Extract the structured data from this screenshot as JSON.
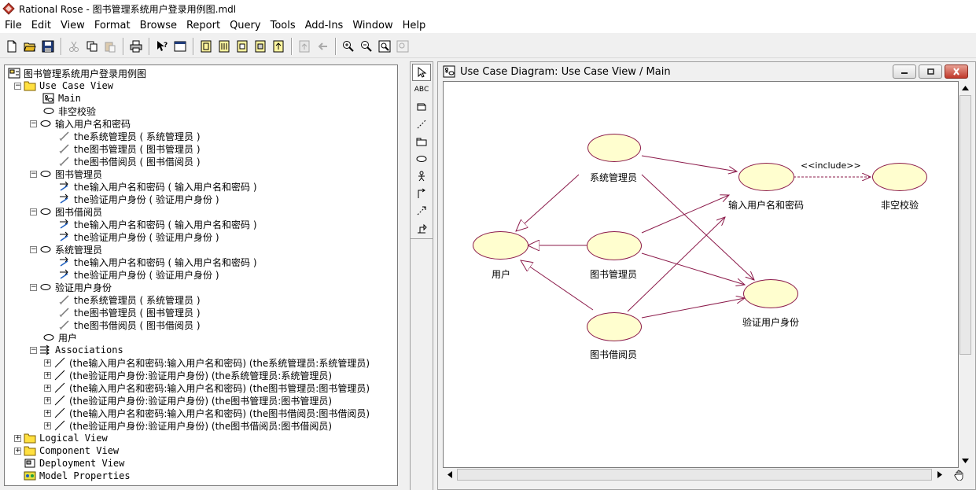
{
  "window": {
    "title": "Rational Rose - 图书管理系统用户登录用例图.mdl"
  },
  "menu": [
    "File",
    "Edit",
    "View",
    "Format",
    "Browse",
    "Report",
    "Query",
    "Tools",
    "Add-Ins",
    "Window",
    "Help"
  ],
  "toolbar": {
    "groups": [
      [
        "new-icon",
        "open-icon",
        "save-icon"
      ],
      [
        "cut-icon",
        "copy-icon",
        "paste-icon"
      ],
      [
        "print-icon"
      ],
      [
        "context-help-icon",
        "view-doc-icon"
      ],
      [
        "browse-class-icon",
        "browse-interaction-icon",
        "browse-component-icon",
        "browse-deployment-icon",
        "browse-parent-icon"
      ],
      [
        "browse-previous-icon",
        "go-back-icon"
      ],
      [
        "zoom-in-icon",
        "zoom-out-icon",
        "fit-in-window-icon",
        "undo-fit-icon"
      ]
    ]
  },
  "browser": {
    "root": "图书管理系统用户登录用例图",
    "use_case_view": "Use Case View",
    "main": "Main",
    "feikong": "非空校验",
    "shuru": "输入用户名和密码",
    "shuru_children": [
      "the系统管理员 ( 系统管理员 )",
      "the图书管理员 ( 图书管理员 )",
      "the图书借阅员 ( 图书借阅员 )"
    ],
    "tsgly": "图书管理员",
    "tsgly_children": [
      "the输入用户名和密码 ( 输入用户名和密码 )",
      "the验证用户身份 ( 验证用户身份 )"
    ],
    "tsjyy": "图书借阅员",
    "tsjyy_children": [
      "the输入用户名和密码 ( 输入用户名和密码 )",
      "the验证用户身份 ( 验证用户身份 )"
    ],
    "xtgly": "系统管理员",
    "xtgly_children": [
      "the输入用户名和密码 ( 输入用户名和密码 )",
      "the验证用户身份 ( 验证用户身份 )"
    ],
    "yanzheng": "验证用户身份",
    "yanzheng_children": [
      "the系统管理员 ( 系统管理员 )",
      "the图书管理员 ( 图书管理员 )",
      "the图书借阅员 ( 图书借阅员 )"
    ],
    "yonghu": "用户",
    "associations": "Associations",
    "association_items": [
      "(the输入用户名和密码:输入用户名和密码) (the系统管理员:系统管理员)",
      "(the验证用户身份:验证用户身份) (the系统管理员:系统管理员)",
      "(the输入用户名和密码:输入用户名和密码) (the图书管理员:图书管理员)",
      "(the验证用户身份:验证用户身份) (the图书管理员:图书管理员)",
      "(the输入用户名和密码:输入用户名和密码) (the图书借阅员:图书借阅员)",
      "(the验证用户身份:验证用户身份) (the图书借阅员:图书借阅员)"
    ],
    "logical_view": "Logical View",
    "component_view": "Component View",
    "deployment_view": "Deployment View",
    "model_properties": "Model Properties"
  },
  "toolbox": {
    "text_tool": "ABC"
  },
  "diagram": {
    "title": "Use Case Diagram: Use Case View / Main",
    "nodes": {
      "xtgly": "系统管理员",
      "tsgly": "图书管理员",
      "tsjyy": "图书借阅员",
      "yonghu": "用户",
      "shuru": "输入用户名和密码",
      "yanzheng": "验证用户身份",
      "feikong": "非空校验"
    },
    "include_label": "<<include>>",
    "colors": {
      "use_case_fill": "#fffecf",
      "use_case_border": "#8b1a4a",
      "line": "#8b1a4a"
    }
  }
}
